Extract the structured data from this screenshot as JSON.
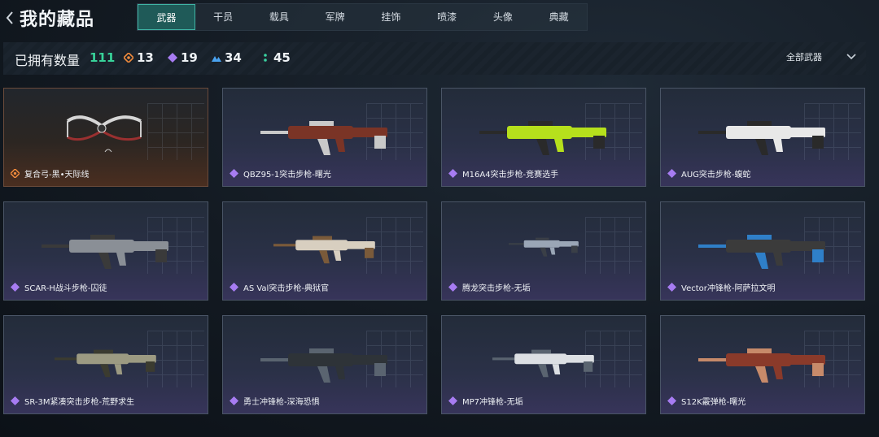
{
  "header": {
    "title": "我的藏品",
    "tabs": [
      {
        "label": "武器",
        "active": true
      },
      {
        "label": "干员",
        "active": false
      },
      {
        "label": "载具",
        "active": false
      },
      {
        "label": "军牌",
        "active": false
      },
      {
        "label": "挂饰",
        "active": false
      },
      {
        "label": "喷漆",
        "active": false
      },
      {
        "label": "头像",
        "active": false
      },
      {
        "label": "典藏",
        "active": false
      }
    ]
  },
  "stats": {
    "owned_label": "已拥有数量",
    "owned_count": "111",
    "rarity_counts": [
      {
        "icon": "orange-diamond-icon",
        "color": "#f08a3c",
        "count": "13"
      },
      {
        "icon": "purple-diamond-icon",
        "color": "#a77cf2",
        "count": "19"
      },
      {
        "icon": "blue-triangles-icon",
        "color": "#4aa3f0",
        "count": "34"
      },
      {
        "icon": "green-dots-icon",
        "color": "#3ad1a0",
        "count": "45"
      }
    ],
    "filter_label": "全部武器"
  },
  "items": [
    {
      "name": "复合弓-黑•天际线",
      "rarity": "orange",
      "weapon": "bow"
    },
    {
      "name": "QBZ95-1突击步枪-曙光",
      "rarity": "purple",
      "weapon": "rifle-red"
    },
    {
      "name": "M16A4突击步枪-竞赛选手",
      "rarity": "purple",
      "weapon": "rifle-lime"
    },
    {
      "name": "AUG突击步枪-蝮蛇",
      "rarity": "purple",
      "weapon": "rifle-white"
    },
    {
      "name": "SCAR-H战斗步枪-囚徒",
      "rarity": "purple",
      "weapon": "rifle-grey"
    },
    {
      "name": "AS Val突击步枪-典狱官",
      "rarity": "purple",
      "weapon": "rifle-tan"
    },
    {
      "name": "腾龙突击步枪-无垢",
      "rarity": "purple",
      "weapon": "rifle-small"
    },
    {
      "name": "Vector冲锋枪-阿萨拉文明",
      "rarity": "purple",
      "weapon": "smg-blue"
    },
    {
      "name": "SR-3M紧凑突击步枪-荒野求生",
      "rarity": "purple",
      "weapon": "rifle-camo"
    },
    {
      "name": "勇士冲锋枪-深海恐惧",
      "rarity": "purple",
      "weapon": "smg-dark"
    },
    {
      "name": "MP7冲锋枪-无垢",
      "rarity": "purple",
      "weapon": "smg-white"
    },
    {
      "name": "S12K霰弹枪-曙光",
      "rarity": "purple",
      "weapon": "shotgun-red"
    }
  ]
}
